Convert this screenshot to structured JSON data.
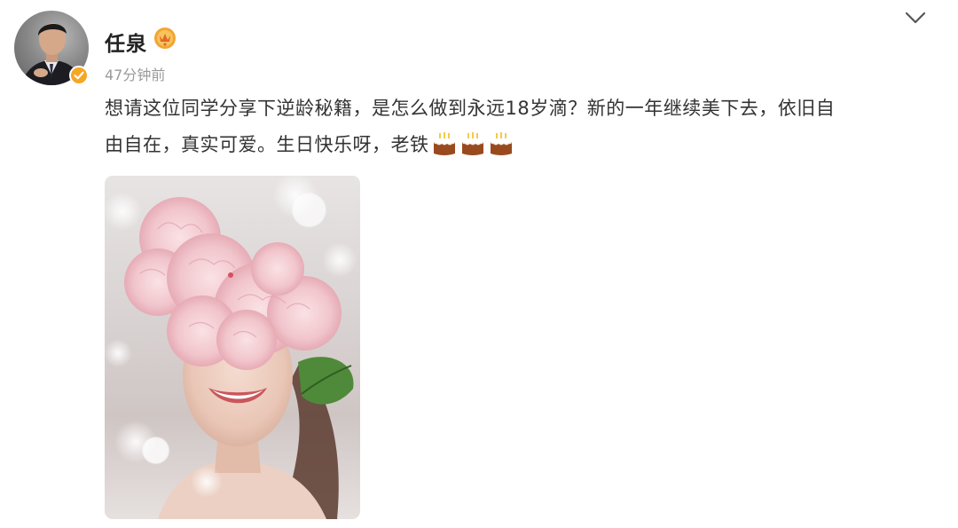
{
  "post": {
    "author": {
      "name": "任泉",
      "timestamp": "47分钟前"
    },
    "text_line_1": "想请这位同学分享下逆龄秘籍，是怎么做到永远18岁滴？新的一年继续美下去，依旧自",
    "text_line_2": "由自在，真实可爱。生日快乐呀，老铁",
    "emojis": [
      "cake-icon",
      "cake-icon",
      "cake-icon"
    ],
    "image": "photo of a smiling woman with pink flowers covering her eyes"
  },
  "colors": {
    "text": "#333333",
    "meta": "#9a9a9a",
    "name": "#222222",
    "badge": "#f5a623"
  }
}
